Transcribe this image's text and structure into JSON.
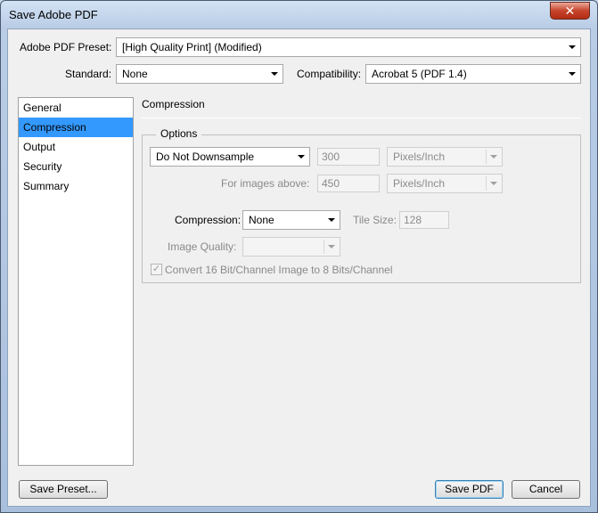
{
  "window": {
    "title": "Save Adobe PDF",
    "close_glyph": "✕"
  },
  "preset": {
    "label": "Adobe PDF Preset:",
    "value": "[High Quality Print] (Modified)"
  },
  "standard": {
    "label": "Standard:",
    "value": "None"
  },
  "compatibility": {
    "label": "Compatibility:",
    "value": "Acrobat 5 (PDF 1.4)"
  },
  "sidebar": {
    "items": [
      {
        "label": "General"
      },
      {
        "label": "Compression"
      },
      {
        "label": "Output"
      },
      {
        "label": "Security"
      },
      {
        "label": "Summary"
      }
    ],
    "selected_index": 1
  },
  "panel": {
    "title": "Compression",
    "options_group_label": "Options",
    "downsample_value": "Do Not Downsample",
    "resolution_value": "300",
    "resolution_unit": "Pixels/Inch",
    "images_above_label": "For images above:",
    "images_above_value": "450",
    "images_above_unit": "Pixels/Inch",
    "compression_label": "Compression:",
    "compression_value": "None",
    "tile_size_label": "Tile Size:",
    "tile_size_value": "128",
    "image_quality_label": "Image Quality:",
    "image_quality_value": "",
    "convert_checkbox_label": "Convert 16 Bit/Channel Image to 8 Bits/Channel",
    "convert_checked": true,
    "check_glyph": "✓"
  },
  "buttons": {
    "save_preset": "Save Preset...",
    "save_pdf": "Save PDF",
    "cancel": "Cancel"
  },
  "colors": {
    "selection": "#3399ff",
    "close_button": "#c7432b"
  },
  "icons": {
    "close": "close-icon",
    "dropdown": "chevron-down-icon",
    "check": "checkmark-icon"
  }
}
